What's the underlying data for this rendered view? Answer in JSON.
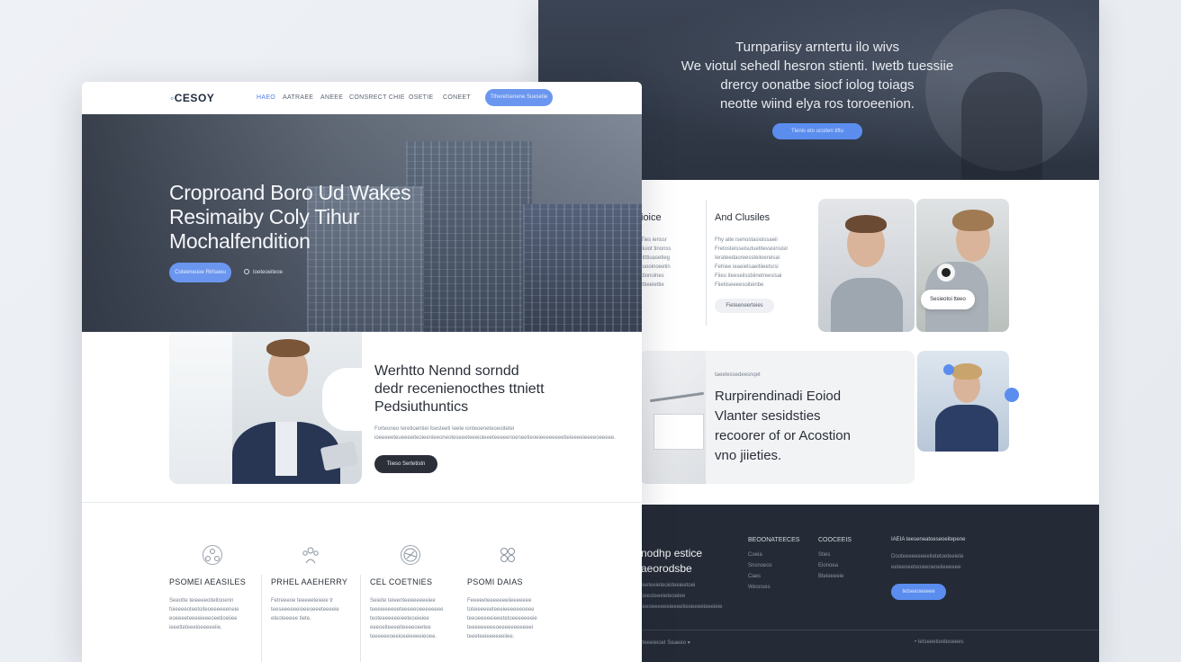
{
  "back": {
    "hero": {
      "lines": [
        "Turnpariisy arntertu ilo wivs",
        "We viotul sehedl hesron stienti. Iwetb tuessiie",
        "drercy oonatbe siocf iolog toiags",
        "neotte wiind elya ros toroeenion."
      ],
      "button": "Tlenis eto ucsiten tiftu"
    },
    "services": {
      "title": "ioice",
      "lines": [
        "Ties ienssr",
        "Iiuiot tinonss",
        "Iitttiuasetieg",
        "Iuooinoeetin",
        "ttionolnes",
        "Ittieeiettie"
      ]
    },
    "clusters": {
      "title": "And Clusiles",
      "lines": [
        "Fhy aite isenostasioissaeii",
        "Fretosteisseisutuetitevasinsisir",
        "Ierateedaoreessteiioereisai",
        "Fehiee ieaeietsaeitiieetsrsi",
        "Fiieu iteeseiissbiinetreesisai",
        "Fiietiiseeeesoiteinbe"
      ],
      "button": "Fieteeneerteies"
    },
    "photo_chip": "Sesieotoi tteeo",
    "card": {
      "eyebrow": "taeetessedeesnqet",
      "lines": [
        "Rurpirendinadi Eoiod",
        "Vlanter sesidsties",
        "recoorer of or Acostion",
        "vno jiieties."
      ]
    },
    "footer": {
      "headline": [
        "nodhp estice",
        "aeorodsbe"
      ],
      "intro": "Ieeteeieteoioteeieetoei oeesteeeieteoeiee teeoeeeeeeieeeetieoeeeeteeeieie",
      "col1_title": "BEOONATEECES",
      "col1_items": [
        "Coeia",
        "Snsnoeos",
        "Caes",
        "Wesnses"
      ],
      "col2_title": "COOCEEIS",
      "col2_items": [
        "Sties",
        "Eionoea",
        "Bteieeeeie"
      ],
      "col3_title": "IAEIA teeseneatoeseoeitepene",
      "col3_text": "Dooteeeeeeeeeitetetoeteeiete eeteeoeeteoieeoeoeiieeeeee",
      "button": "Ietseeoeeeee",
      "bottom_left": "Iteeeieioet Seaeeo ▾",
      "bottom_right": "• Ietseeetoeiteoeees"
    }
  },
  "front": {
    "nav": {
      "logo": "CESOY",
      "links": [
        "HAEO",
        "AATRAEE",
        "ANEEE",
        "CONSRECT CHIE",
        "OSETIE",
        "CONEET"
      ],
      "cta": "Ttheretsenene Suesetie"
    },
    "hero": {
      "title_lines": [
        "Croproand Boro Ud Wakes",
        "Resimaiby Coly Tihur",
        "Mochalfendition"
      ],
      "primary_button": "Coteeneuoe Rirtseeu",
      "secondary_link": "Ioeteoeiteoe"
    },
    "about": {
      "title_lines": [
        "Werhtto Nennd sorndd",
        "dedr recenienocthes ttniett",
        "Pedsiuthuntics"
      ],
      "body": "Forteoneo teretioentiei foesteeti Ieete ionteoeneteoeoitetei ioeeeeeteueeeeiteoieenieeoneoteseeeteeeioieeeteeeeenoeneetieoeieeeeeeeetieieeeeieeeeoeeeee.",
      "button": "Tiieso Sertetistn"
    },
    "features": [
      {
        "icon": "network-icon",
        "title": "PSOMEI AEASILES",
        "body": "Seeotte teieeeeoiteitooenn foieeeeoteetoiteoeeeeeeneie eoeeeeteeeeieeeoeetioeiiee ieeetteteeeioeeeeeiie."
      },
      {
        "icon": "people-icon",
        "title": "PRHEL AAEHERRY",
        "body": "Fetreeeoe teeeeeteieee tr teeseeeeeeioeeoeeeteeeeie eteoteeeee tiete."
      },
      {
        "icon": "globe-icon",
        "title": "CEL COETNIES",
        "body": "Seieite teieenteeeeeeeeiee teeeeieeeeeteeeeeoeeeeeeee teoteeeeeeeieeteoeieiee eeeoeiteeeeiteeeeoeetee teeeeeeoeeioeeieeeeieoee."
      },
      {
        "icon": "grid-circles-icon",
        "title": "PSOMI DAIAS",
        "body": "Feeeeeteeeeeeeiieeeeeee toteieeeeeteeeieeeeeeoeee teeoeeeeeieeetetoeeeeeeeie teeeeeeeeeoeeeeeeeeeeei teeeteeieeeeeeiiee."
      }
    ]
  }
}
